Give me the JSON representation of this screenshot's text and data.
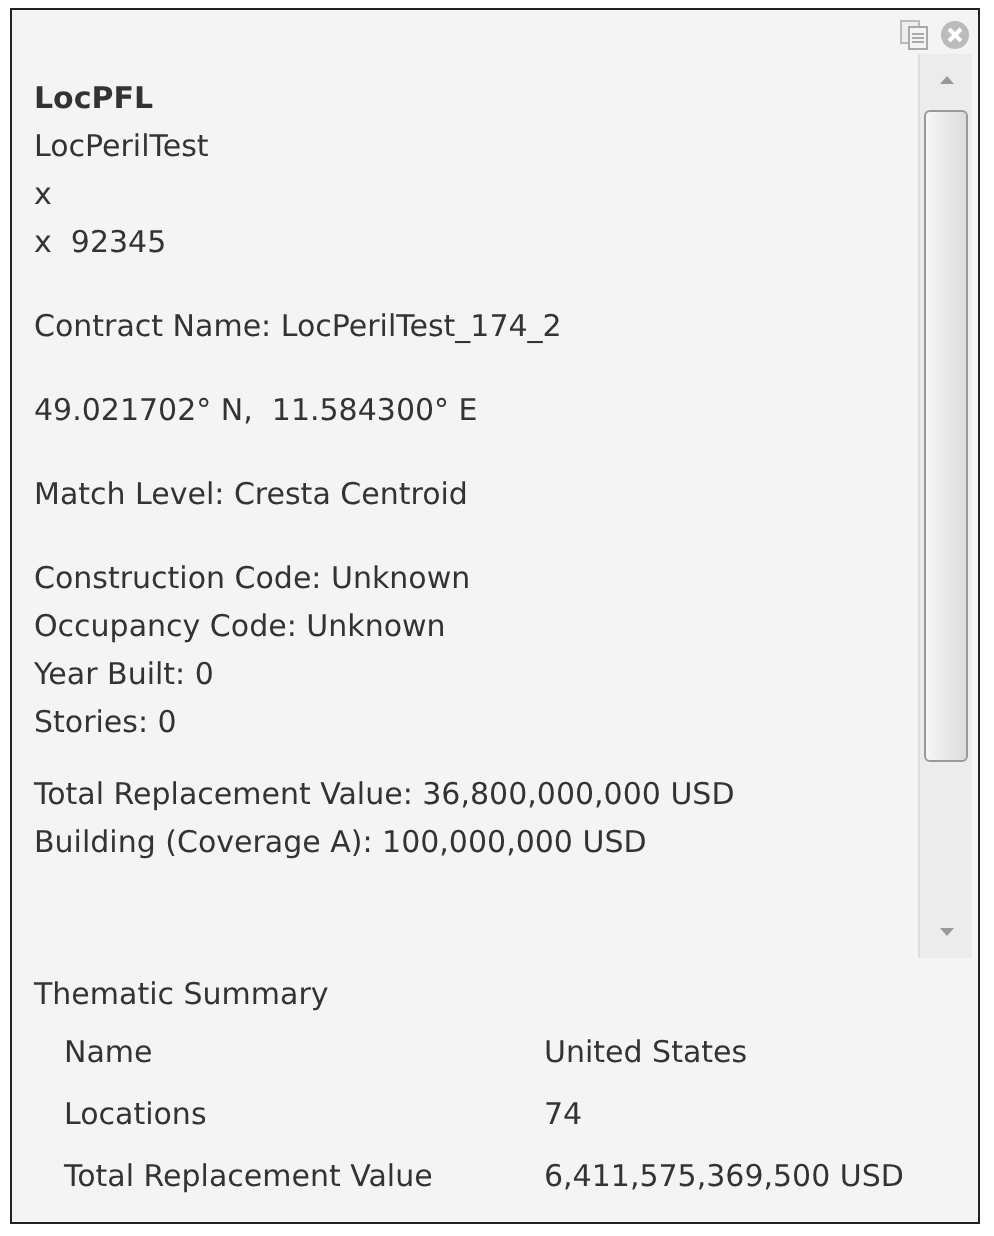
{
  "header": {
    "title": "LocPFL",
    "lines": [
      "LocPerilTest",
      "x",
      "x  92345"
    ]
  },
  "sections": [
    [
      "Contract Name: LocPerilTest_174_2"
    ],
    [
      "49.021702° N,  11.584300° E"
    ],
    [
      "Match Level: Cresta Centroid"
    ],
    [
      "Construction Code: Unknown",
      "Occupancy Code: Unknown",
      "Year Built: 0",
      "Stories: 0"
    ],
    [
      "Total Replacement Value: 36,800,000,000 USD",
      "Building (Coverage A): 100,000,000 USD"
    ]
  ],
  "thematic_summary": {
    "title": "Thematic Summary",
    "rows": [
      {
        "label": "Name",
        "value": "United States"
      },
      {
        "label": "Locations",
        "value": "74"
      },
      {
        "label": "Total Replacement Value",
        "value": "6,411,575,369,500 USD"
      }
    ]
  }
}
